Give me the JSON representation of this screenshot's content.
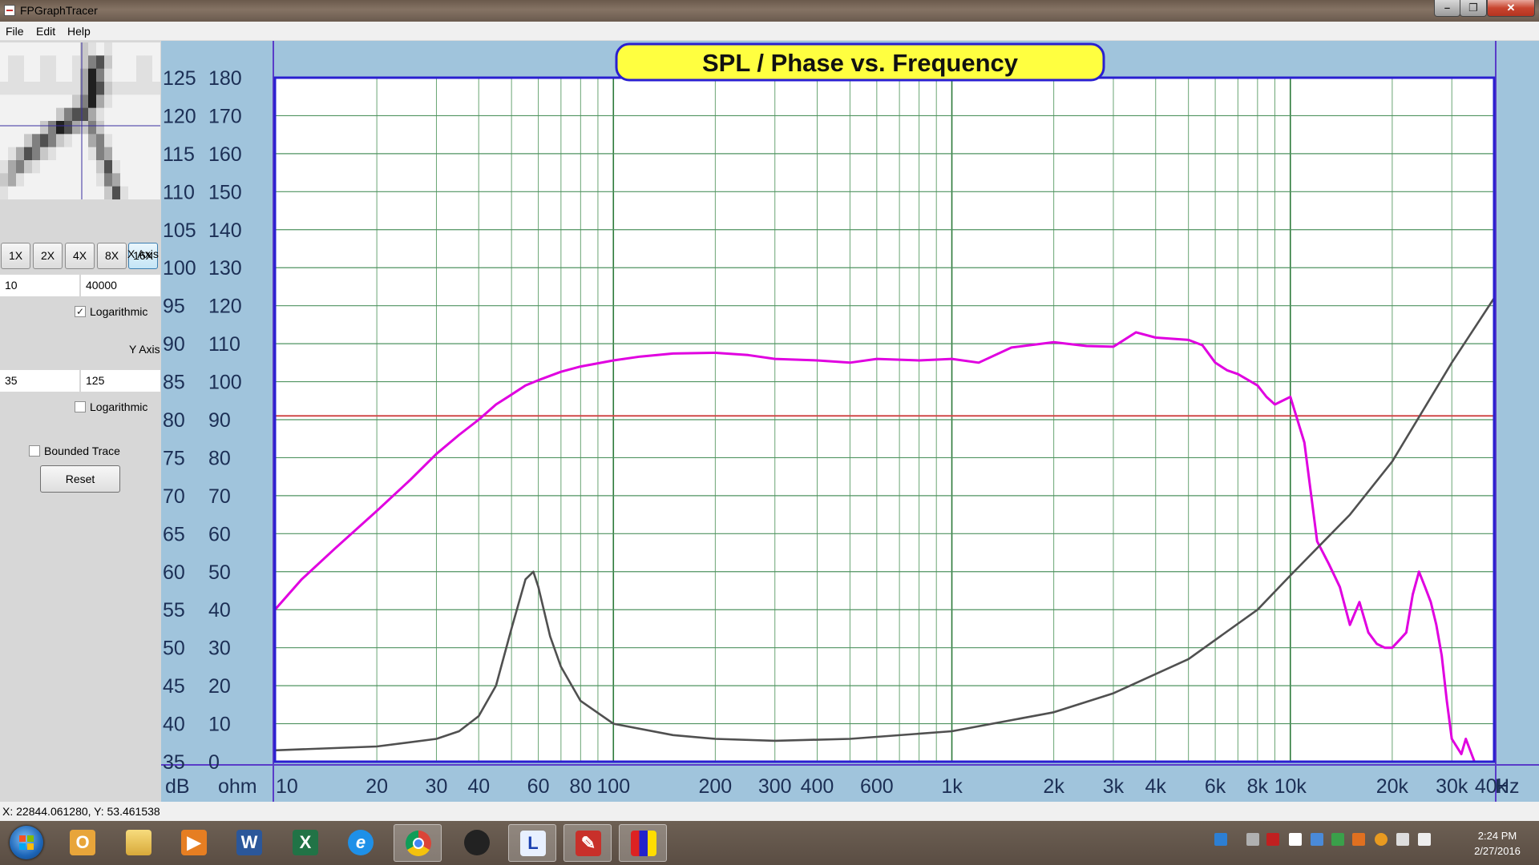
{
  "window": {
    "title": "FPGraphTracer"
  },
  "menu": [
    "File",
    "Edit",
    "Help"
  ],
  "zoom_buttons": [
    "1X",
    "2X",
    "4X",
    "8X",
    "16X"
  ],
  "zoom_selected": "16X",
  "x_axis": {
    "label": "X Axis",
    "min": "10",
    "max": "40000",
    "logarithmic": true,
    "logarithmic_label": "Logarithmic"
  },
  "y_axis": {
    "label": "Y Axis",
    "min": "35",
    "max": "125",
    "logarithmic": false,
    "logarithmic_label": "Logarithmic"
  },
  "bounded_trace": {
    "label": "Bounded Trace",
    "checked": false
  },
  "reset_label": "Reset",
  "status": {
    "coords": "X: 22844.061280, Y: 53.461538"
  },
  "clock": {
    "time": "2:24 PM",
    "date": "2/27/2016"
  },
  "taskbar_apps": [
    "outlook",
    "explorer",
    "media-player",
    "word",
    "excel",
    "internet-explorer",
    "chrome",
    "app-black",
    "app-L",
    "app-red",
    "app-flag"
  ],
  "chart_data": {
    "type": "line",
    "title": "SPL / Phase vs. Frequency",
    "xlabel_unit": "Hz",
    "left_axis_unit": "dB",
    "right_axis_unit": "ohm",
    "x_scale": "log",
    "xlim": [
      10,
      40000
    ],
    "ylim": [
      35,
      125
    ],
    "y2lim": [
      0,
      180
    ],
    "grid": true,
    "x_tick_labels": [
      {
        "v": 10,
        "t": "10"
      },
      {
        "v": 20,
        "t": "20"
      },
      {
        "v": 30,
        "t": "30"
      },
      {
        "v": 40,
        "t": "40"
      },
      {
        "v": 60,
        "t": "60"
      },
      {
        "v": 80,
        "t": "80"
      },
      {
        "v": 100,
        "t": "100"
      },
      {
        "v": 200,
        "t": "200"
      },
      {
        "v": 300,
        "t": "300"
      },
      {
        "v": 400,
        "t": "400"
      },
      {
        "v": 600,
        "t": "600"
      },
      {
        "v": 1000,
        "t": "1k"
      },
      {
        "v": 2000,
        "t": "2k"
      },
      {
        "v": 3000,
        "t": "3k"
      },
      {
        "v": 4000,
        "t": "4k"
      },
      {
        "v": 6000,
        "t": "6k"
      },
      {
        "v": 8000,
        "t": "8k"
      },
      {
        "v": 10000,
        "t": "10k"
      },
      {
        "v": 20000,
        "t": "20k"
      },
      {
        "v": 30000,
        "t": "30k"
      },
      {
        "v": 40000,
        "t": "40k"
      }
    ],
    "y_ticks_db": [
      35,
      40,
      45,
      50,
      55,
      60,
      65,
      70,
      75,
      80,
      85,
      90,
      95,
      100,
      105,
      110,
      115,
      120,
      125
    ],
    "y_ticks_ohm": [
      0,
      10,
      20,
      30,
      40,
      50,
      60,
      70,
      80,
      90,
      100,
      110,
      120,
      130,
      140,
      150,
      160,
      170,
      180
    ],
    "reference_line_db": 80.5,
    "series": [
      {
        "color": "#e000e0",
        "x": [
          10,
          12,
          15,
          20,
          25,
          30,
          35,
          40,
          45,
          50,
          55,
          60,
          70,
          80,
          100,
          120,
          150,
          200,
          250,
          300,
          400,
          500,
          600,
          800,
          1000,
          1200,
          1500,
          2000,
          2500,
          3000,
          3500,
          4000,
          5000,
          5500,
          6000,
          6500,
          7000,
          8000,
          8500,
          9000,
          10000,
          11000,
          12000,
          13000,
          14000,
          15000,
          16000,
          17000,
          18000,
          19000,
          20000,
          21000,
          22000,
          23000,
          24000,
          25000,
          26000,
          27000,
          28000,
          29000,
          30000,
          32000,
          33000,
          35000,
          37000,
          38000,
          40000
        ],
        "y": [
          55,
          59,
          63,
          68,
          72,
          75.5,
          78,
          80,
          82,
          83.3,
          84.5,
          85.2,
          86.3,
          87,
          87.8,
          88.3,
          88.7,
          88.8,
          88.5,
          88,
          87.8,
          87.5,
          88,
          87.8,
          88,
          87.5,
          89.5,
          90.2,
          89.7,
          89.6,
          91.5,
          90.8,
          90.5,
          89.8,
          87.5,
          86.5,
          86,
          84.5,
          83,
          82,
          83,
          77,
          64,
          61,
          58,
          53,
          56,
          52,
          50.5,
          50,
          50,
          51,
          52,
          57,
          60,
          58,
          56,
          53,
          49,
          43,
          38,
          36,
          38,
          35,
          33,
          31,
          28
        ]
      },
      {
        "color": "#505050",
        "x": [
          10,
          20,
          30,
          35,
          40,
          45,
          50,
          55,
          58,
          60,
          65,
          70,
          80,
          100,
          150,
          200,
          300,
          500,
          1000,
          2000,
          3000,
          5000,
          8000,
          10000,
          15000,
          20000,
          30000,
          40000
        ],
        "y2": [
          3,
          4,
          6,
          8,
          12,
          20,
          35,
          48,
          50,
          46,
          33,
          25,
          16,
          10,
          7,
          6,
          5.5,
          6,
          8,
          13,
          18,
          27,
          40,
          49,
          65,
          79,
          105,
          122
        ]
      }
    ]
  }
}
